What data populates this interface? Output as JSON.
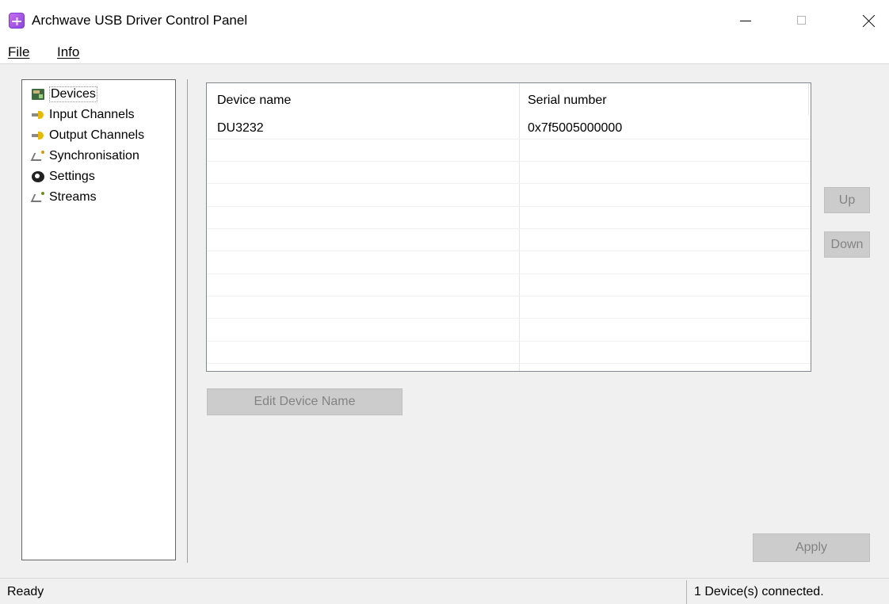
{
  "window": {
    "title": "Archwave USB Driver Control Panel"
  },
  "menu": {
    "file": "File",
    "info": "Info"
  },
  "tree": {
    "items": [
      {
        "label": "Devices",
        "icon": "devices-icon",
        "selected": true
      },
      {
        "label": "Input Channels",
        "icon": "channels-icon"
      },
      {
        "label": "Output Channels",
        "icon": "channels-icon"
      },
      {
        "label": "Synchronisation",
        "icon": "sync-icon"
      },
      {
        "label": "Settings",
        "icon": "settings-icon"
      },
      {
        "label": "Streams",
        "icon": "streams-icon"
      }
    ]
  },
  "devices_table": {
    "columns": [
      "Device name",
      "Serial number"
    ],
    "rows": [
      [
        "DU3232",
        "0x7f5005000000"
      ]
    ]
  },
  "buttons": {
    "up": "Up",
    "down": "Down",
    "edit_device_name": "Edit Device Name",
    "apply": "Apply"
  },
  "status": {
    "left": "Ready",
    "right": "1 Device(s) connected."
  }
}
